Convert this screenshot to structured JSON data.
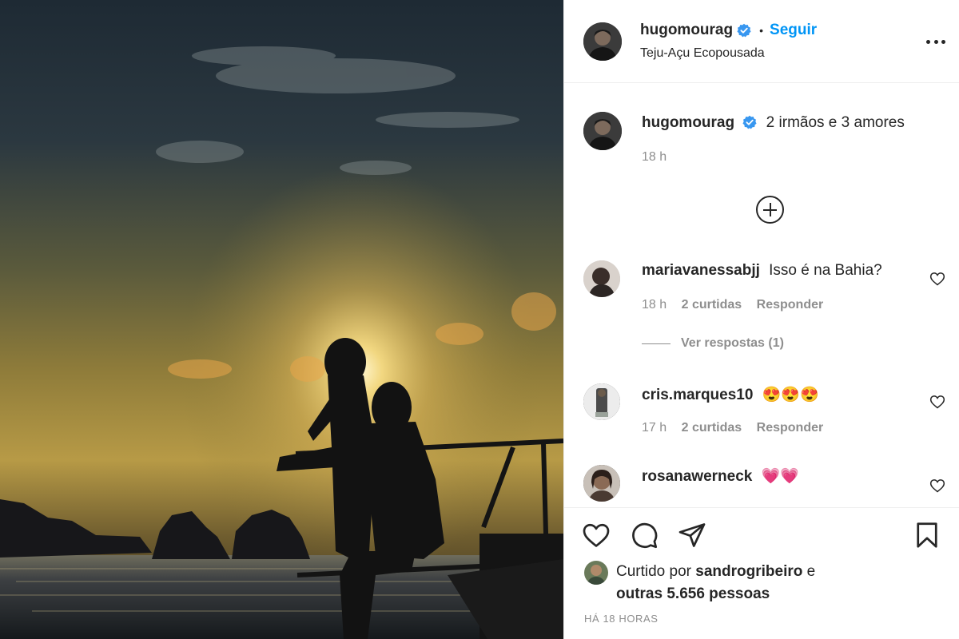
{
  "post": {
    "username": "hugomourag",
    "follow_label": "Seguir",
    "separator": "•",
    "location": "Teju-Açu Ecopousada"
  },
  "caption": {
    "username": "hugomourag",
    "text": "2 irmãos e 3 amores",
    "time": "18 h"
  },
  "comments": [
    {
      "username": "mariavanessabjj",
      "text": "Isso é na Bahia?",
      "time": "18 h",
      "likes": "2 curtidas",
      "reply": "Responder"
    },
    {
      "username": "cris.marques10",
      "text": "😍😍😍",
      "time": "17 h",
      "likes": "2 curtidas",
      "reply": "Responder"
    },
    {
      "username": "rosanawerneck",
      "text": "💗💗",
      "time": "",
      "likes": "",
      "reply": ""
    }
  ],
  "view_replies": "Ver respostas (1)",
  "likes": {
    "prefix": "Curtido por",
    "user": "sandrogribeiro",
    "conj": "e",
    "others": "outras 5.656 pessoas"
  },
  "posted_ago": "HÁ 18 HORAS",
  "colors": {
    "accent": "#0095f6",
    "text": "#262626",
    "muted": "#8e8e8e",
    "divider": "#efefef"
  },
  "icons": [
    "verified-badge-icon",
    "more-options-icon",
    "load-more-icon",
    "heart-icon",
    "comment-icon",
    "share-icon",
    "save-icon"
  ]
}
